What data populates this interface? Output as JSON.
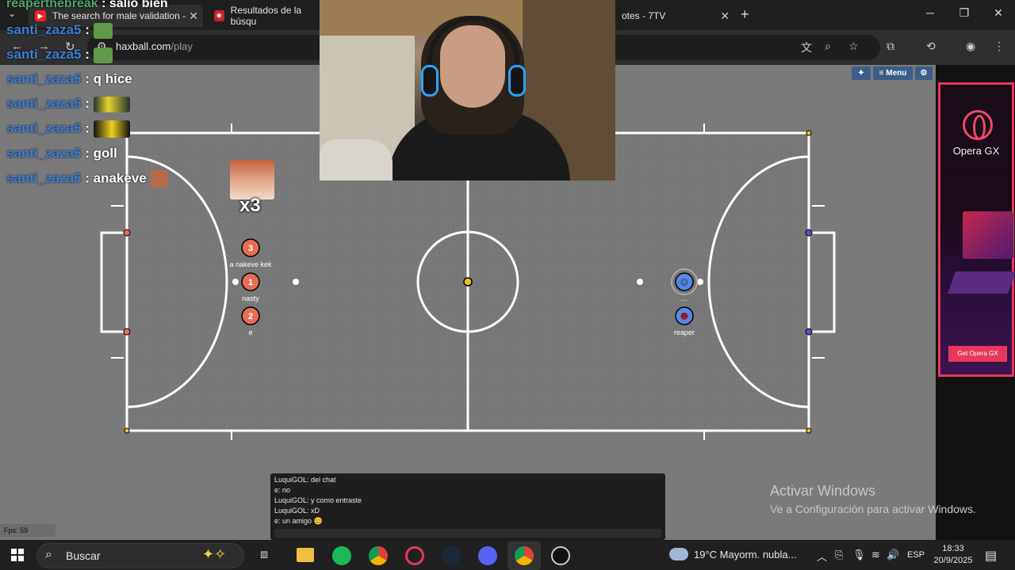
{
  "browser": {
    "tabs": [
      {
        "title": "The search for male validation -"
      },
      {
        "title": "Resultados de la búsqu"
      },
      {
        "title": "otes - 7TV"
      }
    ],
    "url_host": "haxball.com",
    "url_path": "/play"
  },
  "game_menu": {
    "menu_label": "Menu"
  },
  "overlay_chat": [
    {
      "user": "reaperthebreak",
      "sep": ":",
      "text": "salio bien"
    },
    {
      "user": "santi_zaza5",
      "sep": ":",
      "text": ""
    },
    {
      "user": "santi_zaza5",
      "sep": ":",
      "text": ""
    },
    {
      "user": "santi_zaza5",
      "sep": ":",
      "text": "q hice"
    },
    {
      "user": "santi_zaza5",
      "sep": ":",
      "text": ""
    },
    {
      "user": "santi_zaza5",
      "sep": ":",
      "text": ""
    },
    {
      "user": "santi_zaza5",
      "sep": ":",
      "text": "goll"
    },
    {
      "user": "santi_zaza5",
      "sep": ":",
      "text": "anakeve"
    }
  ],
  "emote_multiplier": "x3",
  "players": [
    {
      "number": "3",
      "name": "a nakeve kek",
      "team": "red"
    },
    {
      "number": "1",
      "name": "nasty",
      "team": "red"
    },
    {
      "number": "2",
      "name": "e",
      "team": "red"
    },
    {
      "number": "",
      "name": "",
      "team": "blue"
    },
    {
      "number": "",
      "name": "reaper",
      "team": "blue"
    }
  ],
  "chat_log": [
    "LuquiGOL: del chat",
    "e: no",
    "LuquiGOL: y como entraste",
    "LuquiGOL: xD",
    "e: un amigo 😊"
  ],
  "fps": "Fps: 59",
  "ad": {
    "brand": "Opera GX",
    "cta": "Get Opera GX"
  },
  "windows_notice": {
    "title": "Activar Windows",
    "subtitle": "Ve a Configuración para activar Windows."
  },
  "taskbar": {
    "search_label": "Buscar",
    "weather": "19°C  Mayorm. nubla...",
    "language": "ESP",
    "time": "18:33",
    "date": "20/9/2025"
  },
  "colors": {
    "field": "#7a7a7a",
    "red_team": "#e56e56",
    "blue_team": "#5689e5",
    "ball": "#e8c61a",
    "username": "#3b7fd6",
    "ad_accent": "#e8375a"
  }
}
